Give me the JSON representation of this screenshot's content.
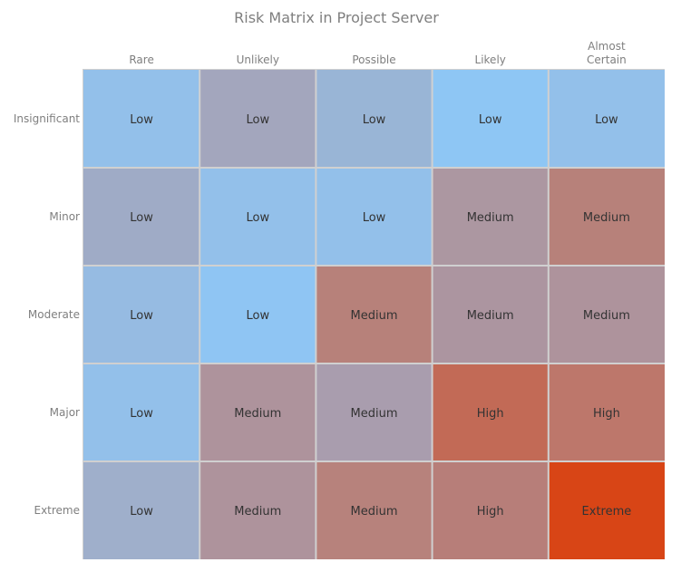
{
  "chart_data": {
    "type": "heatmap",
    "title": "Risk Matrix in Project Server",
    "xlabel": "",
    "ylabel": "",
    "columns": [
      "Rare",
      "Unlikely",
      "Possible",
      "Likely",
      "Almost Certain"
    ],
    "column_label_lines": [
      [
        "Rare"
      ],
      [
        "Unlikely"
      ],
      [
        "Possible"
      ],
      [
        "Likely"
      ],
      [
        "Almost",
        "Certain"
      ]
    ],
    "rows": [
      "Insignificant",
      "Minor",
      "Moderate",
      "Major",
      "Extreme"
    ],
    "cells": [
      [
        {
          "label": "Low",
          "color": "#93c0ea"
        },
        {
          "label": "Low",
          "color": "#a3a6bd"
        },
        {
          "label": "Low",
          "color": "#99b5d6"
        },
        {
          "label": "Low",
          "color": "#8ec6f4"
        },
        {
          "label": "Low",
          "color": "#93c0ea"
        }
      ],
      [
        {
          "label": "Low",
          "color": "#9fabc6"
        },
        {
          "label": "Low",
          "color": "#93c0ea"
        },
        {
          "label": "Low",
          "color": "#93c0ea"
        },
        {
          "label": "Medium",
          "color": "#ac97a1"
        },
        {
          "label": "Medium",
          "color": "#b7817a"
        }
      ],
      [
        {
          "label": "Low",
          "color": "#96bbe2"
        },
        {
          "label": "Low",
          "color": "#8fc5f3"
        },
        {
          "label": "Medium",
          "color": "#b7817a"
        },
        {
          "label": "Medium",
          "color": "#ac95a0"
        },
        {
          "label": "Medium",
          "color": "#ae939c"
        }
      ],
      [
        {
          "label": "Low",
          "color": "#93c0ea"
        },
        {
          "label": "Medium",
          "color": "#ae939c"
        },
        {
          "label": "Medium",
          "color": "#a99dae"
        },
        {
          "label": "High",
          "color": "#c26a56"
        },
        {
          "label": "High",
          "color": "#bd776b"
        }
      ],
      [
        {
          "label": "Low",
          "color": "#9fafcb"
        },
        {
          "label": "Medium",
          "color": "#ae939c"
        },
        {
          "label": "Medium",
          "color": "#b7827c"
        },
        {
          "label": "High",
          "color": "#b77e79"
        },
        {
          "label": "Extreme",
          "color": "#d84516"
        }
      ]
    ],
    "legend": "none",
    "grid": false
  }
}
